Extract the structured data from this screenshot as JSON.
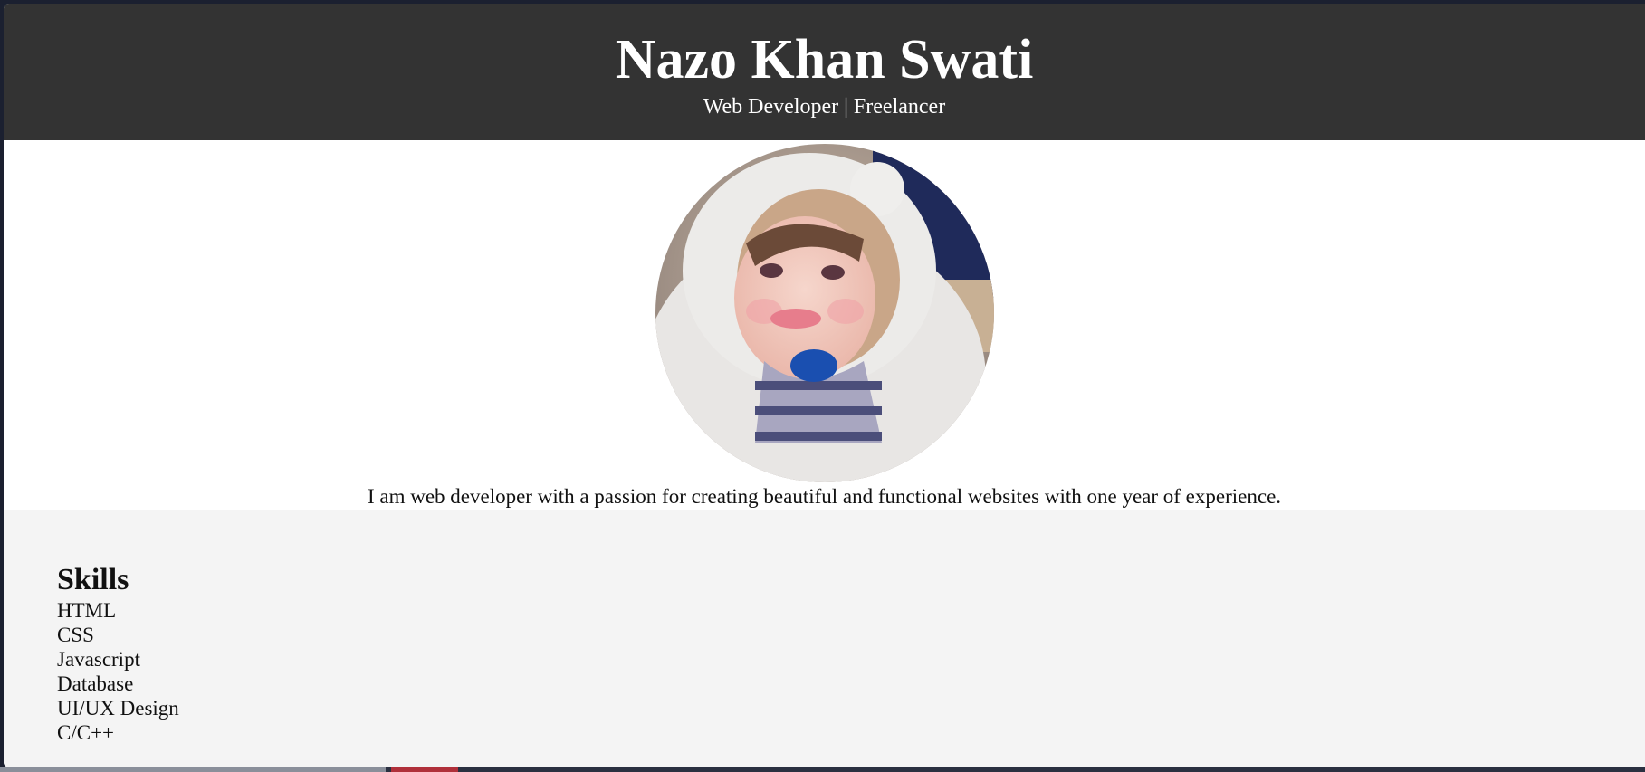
{
  "header": {
    "title": "Nazo Khan Swati",
    "subtitle": "Web Developer | Freelancer"
  },
  "about": {
    "photo_alt": "profile-photo",
    "text": "I am web developer with a passion for creating beautiful and functional websites with one year of experience."
  },
  "skills": {
    "heading": "Skills",
    "items": [
      "HTML",
      "CSS",
      "Javascript",
      "Database",
      "UI/UX Design",
      "C/C++"
    ]
  },
  "colors": {
    "header_bg": "#333333",
    "header_text": "#ffffff",
    "skills_bg": "#f4f4f4"
  }
}
